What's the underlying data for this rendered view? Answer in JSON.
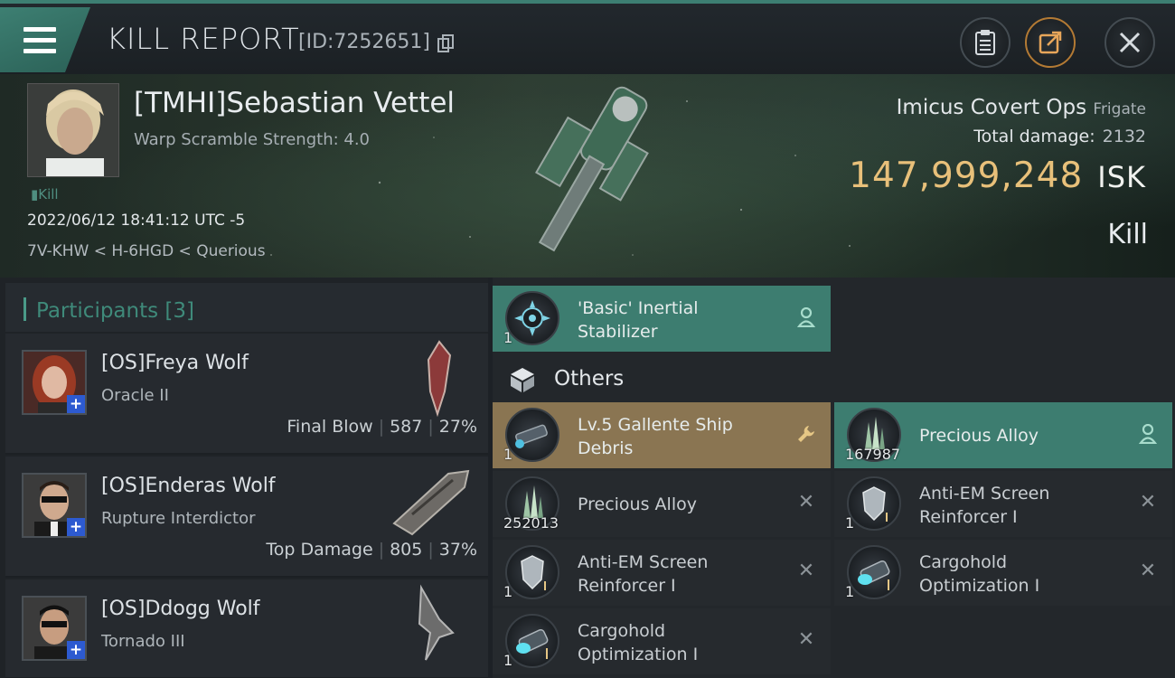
{
  "header": {
    "title": "KILL REPORT",
    "report_id": "[ID:7252651]",
    "icons": [
      "menu-icon",
      "copy-icon",
      "clipboard-icon",
      "share-icon",
      "close-icon"
    ]
  },
  "victim": {
    "name": "[TMHI]Sebastian Vettel",
    "subtitle": "Warp Scramble Strength: 4.0",
    "kill_tag": "Kill",
    "datetime": "2022/06/12 18:41:12 UTC -5",
    "location": "7V-KHW < H-6HGD < Querious",
    "ship_name": "Imicus Covert Ops",
    "ship_class": "Frigate",
    "total_damage_label": "Total damage:",
    "total_damage": "2132",
    "isk_value": "147,999,248",
    "isk_unit": "ISK",
    "result": "Kill"
  },
  "participants": {
    "label": "Participants [3]",
    "rows": [
      {
        "name": "[OS]Freya Wolf",
        "ship": "Oracle II",
        "tag": "Final Blow",
        "damage": "587",
        "percent": "27%"
      },
      {
        "name": "[OS]Enderas Wolf",
        "ship": "Rupture Interdictor",
        "tag": "Top Damage",
        "damage": "805",
        "percent": "37%"
      },
      {
        "name": "[OS]Ddogg Wolf",
        "ship": "Tornado III",
        "tag": "",
        "damage": "",
        "percent": ""
      }
    ]
  },
  "loot": {
    "fitted": [
      {
        "name_line1": "'Basic' Inertial",
        "name_line2": "Stabilizer",
        "qty": "1",
        "state": "dropped"
      }
    ],
    "others_label": "Others",
    "items": [
      {
        "name_line1": "Lv.5 Gallente Ship",
        "name_line2": "Debris",
        "qty": "1",
        "state": "salvage"
      },
      {
        "name_line1": "Precious Alloy",
        "name_line2": "",
        "qty": "167987",
        "state": "dropped"
      },
      {
        "name_line1": "Precious Alloy",
        "name_line2": "",
        "qty": "252013",
        "state": "destroyed"
      },
      {
        "name_line1": "Anti-EM Screen",
        "name_line2": "Reinforcer I",
        "qty": "1",
        "state": "destroyed"
      },
      {
        "name_line1": "Anti-EM Screen",
        "name_line2": "Reinforcer I",
        "qty": "1",
        "state": "destroyed"
      },
      {
        "name_line1": "Cargohold",
        "name_line2": "Optimization I",
        "qty": "1",
        "state": "destroyed"
      },
      {
        "name_line1": "Cargohold",
        "name_line2": "Optimization I",
        "qty": "1",
        "state": "destroyed"
      }
    ]
  },
  "colors": {
    "accent_teal": "#3d7d70",
    "accent_gold": "#8a7552",
    "isk_gold": "#e8c07a",
    "badge_blue": "#2d5ad0"
  }
}
